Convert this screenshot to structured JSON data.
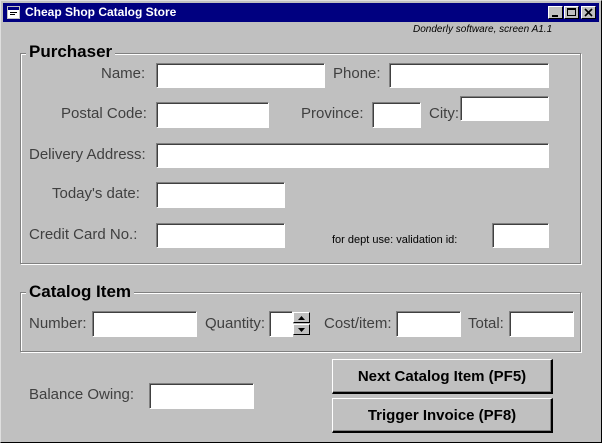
{
  "window": {
    "title": "Cheap Shop Catalog Store",
    "note": "Donderly software, screen A1.1"
  },
  "purchaser": {
    "legend": "Purchaser",
    "name_label": "Name:",
    "name_value": "",
    "phone_label": "Phone:",
    "phone_value": "",
    "postal_label": "Postal Code:",
    "postal_value": "",
    "province_label": "Province:",
    "province_value": "",
    "city_label": "City:",
    "city_value": "",
    "delivery_label": "Delivery Address:",
    "delivery_value": "",
    "date_label": "Today's date:",
    "date_value": "",
    "cc_label": "Credit Card No.:",
    "cc_value": "",
    "validation_label": "for dept use: validation id:",
    "validation_value": ""
  },
  "catalog": {
    "legend": "Catalog Item",
    "number_label": "Number:",
    "number_value": "",
    "quantity_label": "Quantity:",
    "quantity_value": "",
    "cost_label": "Cost/item:",
    "cost_value": "",
    "total_label": "Total:",
    "total_value": ""
  },
  "footer": {
    "balance_label": "Balance Owing:",
    "balance_value": "",
    "next_button": "Next Catalog Item (PF5)",
    "invoice_button": "Trigger Invoice (PF8)"
  },
  "icons": {
    "app": "app-icon",
    "minimize": "minimize-icon",
    "maximize": "maximize-icon",
    "close": "close-icon",
    "spin_up": "triangle-up-icon",
    "spin_down": "triangle-down-icon"
  }
}
